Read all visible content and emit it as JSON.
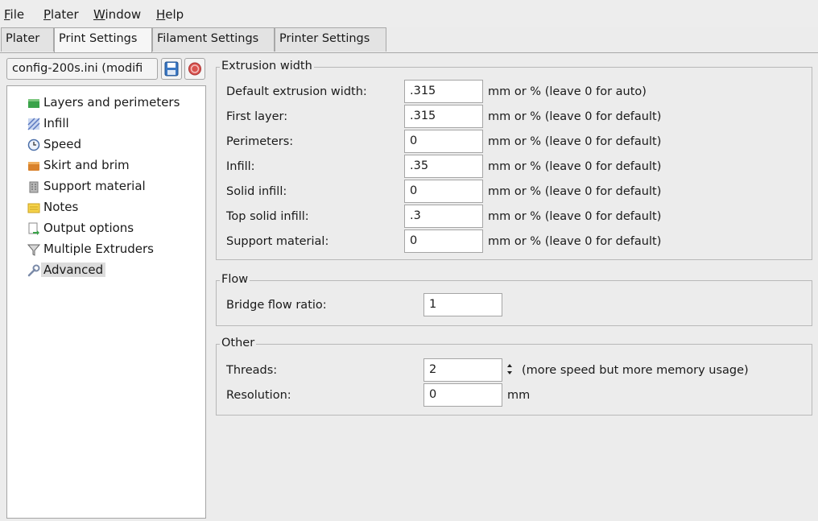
{
  "menu": {
    "items": [
      {
        "u": "F",
        "rest": "ile"
      },
      {
        "u": "P",
        "rest": "later"
      },
      {
        "u": "W",
        "rest": "indow"
      },
      {
        "u": "H",
        "rest": "elp"
      }
    ]
  },
  "tabs": [
    "Plater",
    "Print Settings",
    "Filament Settings",
    "Printer Settings"
  ],
  "preset": {
    "value": "config-200s.ini (modifi"
  },
  "tree": {
    "items": [
      {
        "label": "Layers and perimeters"
      },
      {
        "label": "Infill"
      },
      {
        "label": "Speed"
      },
      {
        "label": "Skirt and brim"
      },
      {
        "label": "Support material"
      },
      {
        "label": "Notes"
      },
      {
        "label": "Output options"
      },
      {
        "label": "Multiple Extruders"
      },
      {
        "label": "Advanced"
      }
    ]
  },
  "extrusion": {
    "title": "Extrusion width",
    "rows": [
      {
        "label": "Default extrusion width:",
        "value": ".315",
        "hint": "mm or % (leave 0 for auto)"
      },
      {
        "label": "First layer:",
        "value": ".315",
        "hint": "mm or % (leave 0 for default)"
      },
      {
        "label": "Perimeters:",
        "value": "0",
        "hint": "mm or % (leave 0 for default)"
      },
      {
        "label": "Infill:",
        "value": ".35",
        "hint": "mm or % (leave 0 for default)"
      },
      {
        "label": "Solid infill:",
        "value": "0",
        "hint": "mm or % (leave 0 for default)"
      },
      {
        "label": "Top solid infill:",
        "value": ".3",
        "hint": "mm or % (leave 0 for default)"
      },
      {
        "label": "Support material:",
        "value": "0",
        "hint": "mm or % (leave 0 for default)"
      }
    ]
  },
  "flow": {
    "title": "Flow",
    "bridge_label": "Bridge flow ratio:",
    "bridge_value": "1"
  },
  "other": {
    "title": "Other",
    "threads_label": "Threads:",
    "threads_value": "2",
    "threads_hint": "(more speed but more memory usage)",
    "resolution_label": "Resolution:",
    "resolution_value": "0",
    "resolution_unit": "mm"
  }
}
